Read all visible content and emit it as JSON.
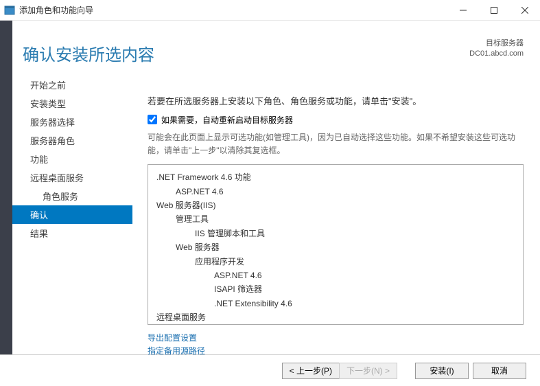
{
  "window": {
    "title": "添加角色和功能向导"
  },
  "heading": "确认安装所选内容",
  "target": {
    "label": "目标服务器",
    "value": "DC01.abcd.com"
  },
  "sidebar": {
    "items": [
      {
        "label": "开始之前",
        "selected": false
      },
      {
        "label": "安装类型",
        "selected": false
      },
      {
        "label": "服务器选择",
        "selected": false
      },
      {
        "label": "服务器角色",
        "selected": false
      },
      {
        "label": "功能",
        "selected": false
      },
      {
        "label": "远程桌面服务",
        "selected": false
      },
      {
        "label": "角色服务",
        "selected": false,
        "sub": true
      },
      {
        "label": "确认",
        "selected": true
      },
      {
        "label": "结果",
        "selected": false
      }
    ]
  },
  "instruction": "若要在所选服务器上安装以下角色、角色服务或功能，请单击\"安装\"。",
  "checkbox": {
    "label": "如果需要，自动重新启动目标服务器",
    "checked": true
  },
  "subinstruction": "可能会在此页面上显示可选功能(如管理工具)，因为已自动选择这些功能。如果不希望安装这些可选功能，请单击\"上一步\"以清除其复选框。",
  "features": [
    {
      "text": ".NET Framework 4.6 功能",
      "indent": 0
    },
    {
      "text": "ASP.NET 4.6",
      "indent": 1
    },
    {
      "text": "Web 服务器(IIS)",
      "indent": 0
    },
    {
      "text": "管理工具",
      "indent": 1
    },
    {
      "text": "IIS 管理脚本和工具",
      "indent": 2
    },
    {
      "text": "Web 服务器",
      "indent": 1
    },
    {
      "text": "应用程序开发",
      "indent": 2
    },
    {
      "text": "ASP.NET 4.6",
      "indent": 3
    },
    {
      "text": "ISAPI 筛选器",
      "indent": 3
    },
    {
      "text": ".NET Extensibility 4.6",
      "indent": 3
    },
    {
      "text": "远程桌面服务",
      "indent": 0
    }
  ],
  "links": {
    "export": "导出配置设置",
    "altsrc": "指定备用源路径"
  },
  "buttons": {
    "prev": "< 上一步(P)",
    "next": "下一步(N) >",
    "install": "安装(I)",
    "cancel": "取消"
  }
}
